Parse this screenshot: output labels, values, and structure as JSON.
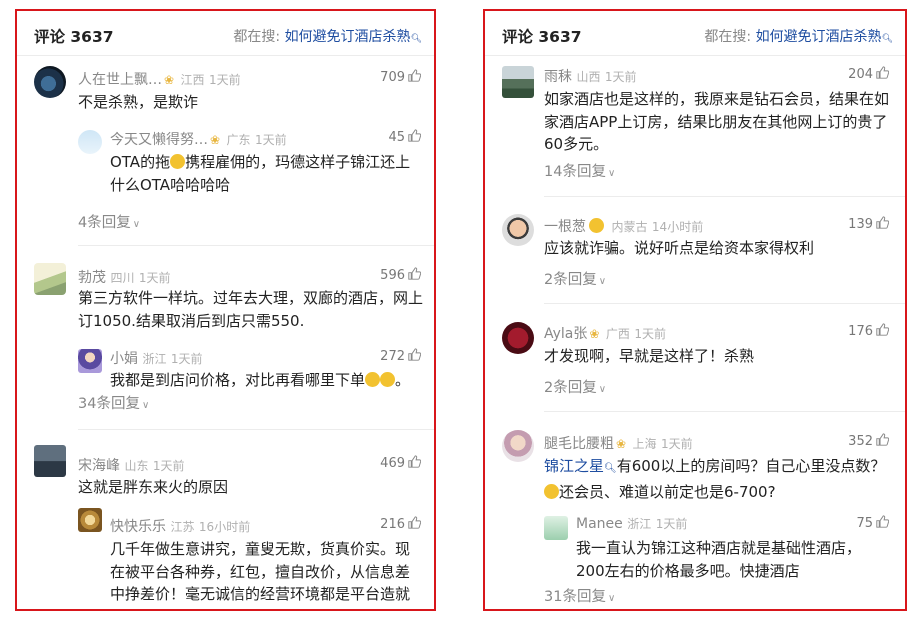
{
  "left": {
    "header": {
      "count_label": "评论 3637",
      "search_prefix": "都在搜:",
      "search_query": "如何避免订酒店杀熟"
    },
    "comments": [
      {
        "user": "人在世上飘…",
        "region": "江西",
        "time": "1天前",
        "likes": "709",
        "text": "不是杀熟，是欺诈",
        "reply": {
          "user": "今天又懒得努…",
          "region": "广东",
          "time": "1天前",
          "likes": "45",
          "text_a": "OTA的拖",
          "text_b": "携程雇佣的，玛德这样子锦江还上什么OTA哈哈哈哈"
        },
        "more": "4条回复"
      },
      {
        "user": "勃茂",
        "region": "四川",
        "time": "1天前",
        "likes": "596",
        "text": "第三方软件一样坑。过年去大理，双廊的酒店，网上订1050.结果取消后到店只需550.",
        "reply": {
          "user": "小娟",
          "region": "浙江",
          "time": "1天前",
          "likes": "272",
          "text": "我都是到店问价格，对比再看哪里下单"
        },
        "more": "34条回复"
      },
      {
        "user": "宋海峰",
        "region": "山东",
        "time": "1天前",
        "likes": "469",
        "text": "这就是胖东来火的原因",
        "reply": {
          "user": "快快乐乐",
          "region": "江苏",
          "time": "16小时前",
          "likes": "216",
          "text": "几千年做生意讲究，童叟无欺，货真价实。现在被平台各种券，红包，擅自改价，从信息差中挣差价！毫无诚信的经营环境都是平台造就的"
        }
      }
    ]
  },
  "right": {
    "header": {
      "count_label": "评论 3637",
      "search_prefix": "都在搜:",
      "search_query": "如何避免订酒店杀熟"
    },
    "comments": [
      {
        "user": "雨秣",
        "region": "山西",
        "time": "1天前",
        "likes": "204",
        "text": "如家酒店也是这样的，我原来是钻石会员，结果在如家酒店APP上订房，结果比朋友在其他网上订的贵了60多元。",
        "more": "14条回复"
      },
      {
        "user": "一根葱",
        "region": "内蒙古",
        "time": "14小时前",
        "likes": "139",
        "text": "应该就诈骗。说好听点是给资本家得权利",
        "more": "2条回复"
      },
      {
        "user": "Ayla张",
        "region": "广西",
        "time": "1天前",
        "likes": "176",
        "text": "才发现啊，早就是这样了！杀熟",
        "more": "2条回复"
      },
      {
        "user": "腿毛比腰粗",
        "region": "上海",
        "time": "1天前",
        "likes": "352",
        "mention": "锦江之星",
        "text_a": "有600以上的房间吗？自己心里没点数？",
        "text_b": "还会员、难道以前定也是6-700?",
        "reply": {
          "user": "Manee",
          "region": "浙江",
          "time": "1天前",
          "likes": "75",
          "text": "我一直认为锦江这种酒店就是基础性酒店，200左右的价格最多吧。快捷酒店"
        },
        "more": "31条回复"
      }
    ]
  },
  "icons": {
    "like": "thumbs-up-icon",
    "vip": "vip-badge-icon",
    "search": "search-icon",
    "chevron": "chevron-down-icon"
  },
  "colors": {
    "border": "#d8161b",
    "link": "#1f4ea1",
    "muted": "#888888",
    "vip": "#e8b640"
  }
}
